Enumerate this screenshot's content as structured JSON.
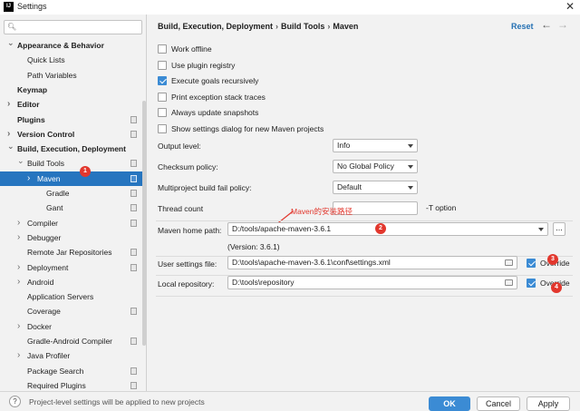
{
  "window": {
    "title": "Settings",
    "app_icon_text": "IJ"
  },
  "search": {
    "placeholder": ""
  },
  "sidebar": {
    "items": [
      {
        "label": "Appearance & Behavior",
        "bold": true,
        "arrow": "down",
        "indent": 0
      },
      {
        "label": "Quick Lists",
        "bold": false,
        "arrow": "",
        "indent": 1
      },
      {
        "label": "Path Variables",
        "bold": false,
        "arrow": "",
        "indent": 1
      },
      {
        "label": "Keymap",
        "bold": true,
        "arrow": "",
        "indent": 0
      },
      {
        "label": "Editor",
        "bold": true,
        "arrow": "right",
        "indent": 0
      },
      {
        "label": "Plugins",
        "bold": true,
        "arrow": "",
        "indent": 0,
        "project": true
      },
      {
        "label": "Version Control",
        "bold": true,
        "arrow": "right",
        "indent": 0,
        "project": true
      },
      {
        "label": "Build, Execution, Deployment",
        "bold": true,
        "arrow": "down",
        "indent": 0
      },
      {
        "label": "Build Tools",
        "bold": false,
        "arrow": "down",
        "indent": 1,
        "project": true
      },
      {
        "label": "Maven",
        "bold": false,
        "arrow": "right",
        "indent": 2,
        "project": true,
        "selected": true
      },
      {
        "label": "Gradle",
        "bold": false,
        "arrow": "",
        "indent": 3,
        "project": true
      },
      {
        "label": "Gant",
        "bold": false,
        "arrow": "",
        "indent": 3,
        "project": true
      },
      {
        "label": "Compiler",
        "bold": false,
        "arrow": "right",
        "indent": 1,
        "project": true
      },
      {
        "label": "Debugger",
        "bold": false,
        "arrow": "right",
        "indent": 1
      },
      {
        "label": "Remote Jar Repositories",
        "bold": false,
        "arrow": "",
        "indent": 1,
        "project": true
      },
      {
        "label": "Deployment",
        "bold": false,
        "arrow": "right",
        "indent": 1,
        "project": true
      },
      {
        "label": "Android",
        "bold": false,
        "arrow": "right",
        "indent": 1
      },
      {
        "label": "Application Servers",
        "bold": false,
        "arrow": "",
        "indent": 1
      },
      {
        "label": "Coverage",
        "bold": false,
        "arrow": "",
        "indent": 1,
        "project": true
      },
      {
        "label": "Docker",
        "bold": false,
        "arrow": "right",
        "indent": 1
      },
      {
        "label": "Gradle-Android Compiler",
        "bold": false,
        "arrow": "",
        "indent": 1,
        "project": true
      },
      {
        "label": "Java Profiler",
        "bold": false,
        "arrow": "right",
        "indent": 1
      },
      {
        "label": "Package Search",
        "bold": false,
        "arrow": "",
        "indent": 1,
        "project": true
      },
      {
        "label": "Required Plugins",
        "bold": false,
        "arrow": "",
        "indent": 1,
        "project": true
      }
    ]
  },
  "breadcrumb": {
    "part1": "Build, Execution, Deployment",
    "part2": "Build Tools",
    "part3": "Maven",
    "separator": "›"
  },
  "header": {
    "reset": "Reset",
    "back": "←",
    "forward": "→"
  },
  "options": {
    "work_offline": "Work offline",
    "plugin_registry": "Use plugin registry",
    "execute_goals": "Execute goals recursively",
    "print_exception": "Print exception stack traces",
    "update_snapshots": "Always update snapshots",
    "show_settings_dialog": "Show settings dialog for new Maven projects"
  },
  "fields": {
    "output_level": {
      "label": "Output level:",
      "value": "Info"
    },
    "checksum_policy": {
      "label": "Checksum policy:",
      "value": "No Global Policy"
    },
    "fail_policy": {
      "label": "Multiproject build fail policy:",
      "value": "Default"
    },
    "thread_count": {
      "label": "Thread count",
      "value": "",
      "hint": "-T option"
    },
    "maven_home": {
      "label": "Maven home path:",
      "value": "D:/tools/apache-maven-3.6.1",
      "version": "(Version: 3.6.1)",
      "browse": "..."
    },
    "user_settings": {
      "label": "User settings file:",
      "value": "D:\\tools\\apache-maven-3.6.1\\conf\\settings.xml",
      "override": "Override"
    },
    "local_repo": {
      "label": "Local repository:",
      "value": "D:\\tools\\repository",
      "override": "Override"
    }
  },
  "annotations": {
    "text": "Maven的安装路径",
    "badge1": "1",
    "badge2": "2",
    "badge3": "3",
    "badge4": "4",
    "color": "#e2372d"
  },
  "footer": {
    "help": "?",
    "info": "i",
    "note": "Project-level settings will be applied to new projects",
    "ok": "OK",
    "cancel": "Cancel",
    "apply": "Apply"
  },
  "colors": {
    "accent": "#3b8bd4",
    "selection": "#2675bf",
    "link": "#2470b3"
  }
}
